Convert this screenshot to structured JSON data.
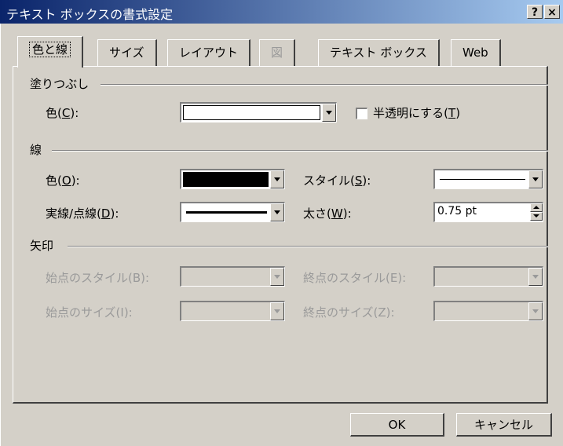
{
  "window": {
    "title": "テキスト ボックスの書式設定",
    "help_label": "?",
    "close_label": "×"
  },
  "tabs": [
    {
      "label": "色と線",
      "active": true,
      "enabled": true
    },
    {
      "label": "サイズ",
      "active": false,
      "enabled": true
    },
    {
      "label": "レイアウト",
      "active": false,
      "enabled": true
    },
    {
      "label": "図",
      "active": false,
      "enabled": false
    },
    {
      "label": "テキスト ボックス",
      "active": false,
      "enabled": true
    },
    {
      "label": "Web",
      "active": false,
      "enabled": true
    }
  ],
  "fill": {
    "heading": "塗りつぶし",
    "color_label": "色",
    "color_key": "C",
    "color_value": "#ffffff",
    "semitransparent_label": "半透明にする",
    "semitransparent_key": "T",
    "semitransparent_checked": false
  },
  "line": {
    "heading": "線",
    "color_label": "色",
    "color_key": "O",
    "color_value": "#000000",
    "dash_label": "実線/点線",
    "dash_key": "D",
    "style_label": "スタイル",
    "style_key": "S",
    "weight_label": "太さ",
    "weight_key": "W",
    "weight_value": "0.75 pt"
  },
  "arrows": {
    "heading": "矢印",
    "begin_style_label": "始点のスタイル(B):",
    "end_style_label": "終点のスタイル(E):",
    "begin_size_label": "始点のサイズ(I):",
    "end_size_label": "終点のサイズ(Z):"
  },
  "buttons": {
    "ok": "OK",
    "cancel": "キャンセル"
  }
}
